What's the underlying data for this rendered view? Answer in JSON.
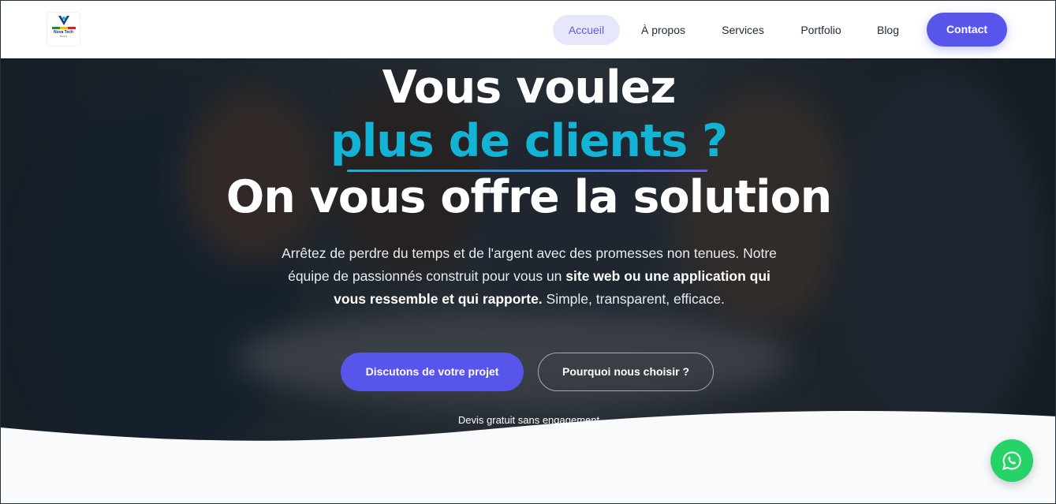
{
  "brand": {
    "logo_name": "Nova Tech",
    "logo_tagline": "BENIN",
    "flag_colors": [
      "#1a8f3c",
      "#f2c200",
      "#d1202f"
    ],
    "mark_color": "#1e3a8a"
  },
  "nav": {
    "items": [
      {
        "label": "Accueil",
        "active": true
      },
      {
        "label": "À propos",
        "active": false
      },
      {
        "label": "Services",
        "active": false
      },
      {
        "label": "Portfolio",
        "active": false
      },
      {
        "label": "Blog",
        "active": false
      }
    ],
    "contact_label": "Contact"
  },
  "hero": {
    "title_line1": "Vous voulez",
    "title_line2": "plus de clients ?",
    "title_line3": "On vous offre la solution",
    "lead_part1": "Arrêtez de perdre du temps et de l'argent avec des promesses non tenues. Notre équipe de passionnés construit pour vous un ",
    "lead_bold": "site web ou une application qui vous ressemble et qui rapporte.",
    "lead_part2": " Simple, transparent, efficace.",
    "cta_primary": "Discutons de votre projet",
    "cta_secondary": "Pourquoi nous choisir ?",
    "note": "Devis gratuit sans engagement"
  },
  "colors": {
    "accent": "#5855eb",
    "highlight": "#13b3d6",
    "whatsapp": "#25d366"
  },
  "floating": {
    "icon": "whatsapp-icon"
  }
}
